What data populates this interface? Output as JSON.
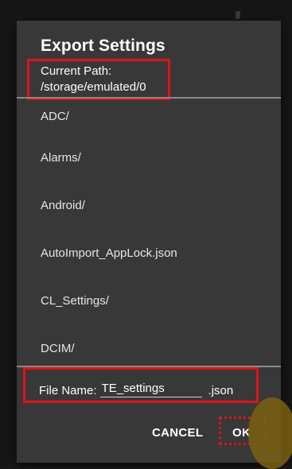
{
  "dialog": {
    "title": "Export Settings",
    "current_path_label": "Current Path:",
    "current_path_value": "/storage/emulated/0",
    "items": [
      {
        "label": "ADC/"
      },
      {
        "label": "Alarms/"
      },
      {
        "label": "Android/"
      },
      {
        "label": "AutoImport_AppLock.json"
      },
      {
        "label": "CL_Settings/"
      },
      {
        "label": "DCIM/"
      }
    ],
    "file_name_label": "File Name:",
    "file_name_value": "TE_settings",
    "file_extension": ".json",
    "cancel_label": "CANCEL",
    "ok_label": "OK"
  },
  "colors": {
    "highlight": "#e0121b",
    "dialog_background": "#383838",
    "accent": "#7a6010"
  }
}
